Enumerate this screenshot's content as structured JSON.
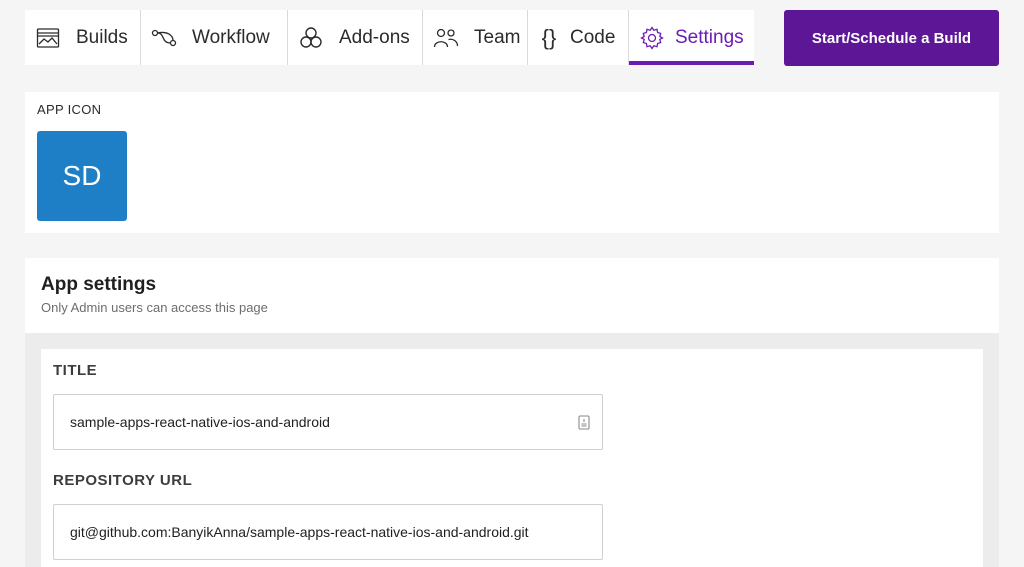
{
  "nav": {
    "tabs": [
      {
        "label": "Builds",
        "icon": "builds-icon"
      },
      {
        "label": "Workflow",
        "icon": "workflow-icon"
      },
      {
        "label": "Add-ons",
        "icon": "addons-icon"
      },
      {
        "label": "Team",
        "icon": "team-icon"
      },
      {
        "label": "Code",
        "icon": "code-braces-icon"
      },
      {
        "label": "Settings",
        "icon": "gear-icon",
        "active": true
      }
    ],
    "code_glyph": "{}",
    "cta_label": "Start/Schedule a Build"
  },
  "app_icon": {
    "label": "APP ICON",
    "initials": "SD",
    "color": "#1f7fc6"
  },
  "app_settings": {
    "title": "App settings",
    "subtitle": "Only Admin users can access this page",
    "fields": [
      {
        "label": "TITLE",
        "value": "sample-apps-react-native-ios-and-android"
      },
      {
        "label": "REPOSITORY URL",
        "value": "git@github.com:BanyikAnna/sample-apps-react-native-ios-and-android.git"
      }
    ]
  },
  "colors": {
    "accent": "#6b1cb5",
    "cta": "#5d1796",
    "background": "#f5f5f5"
  }
}
